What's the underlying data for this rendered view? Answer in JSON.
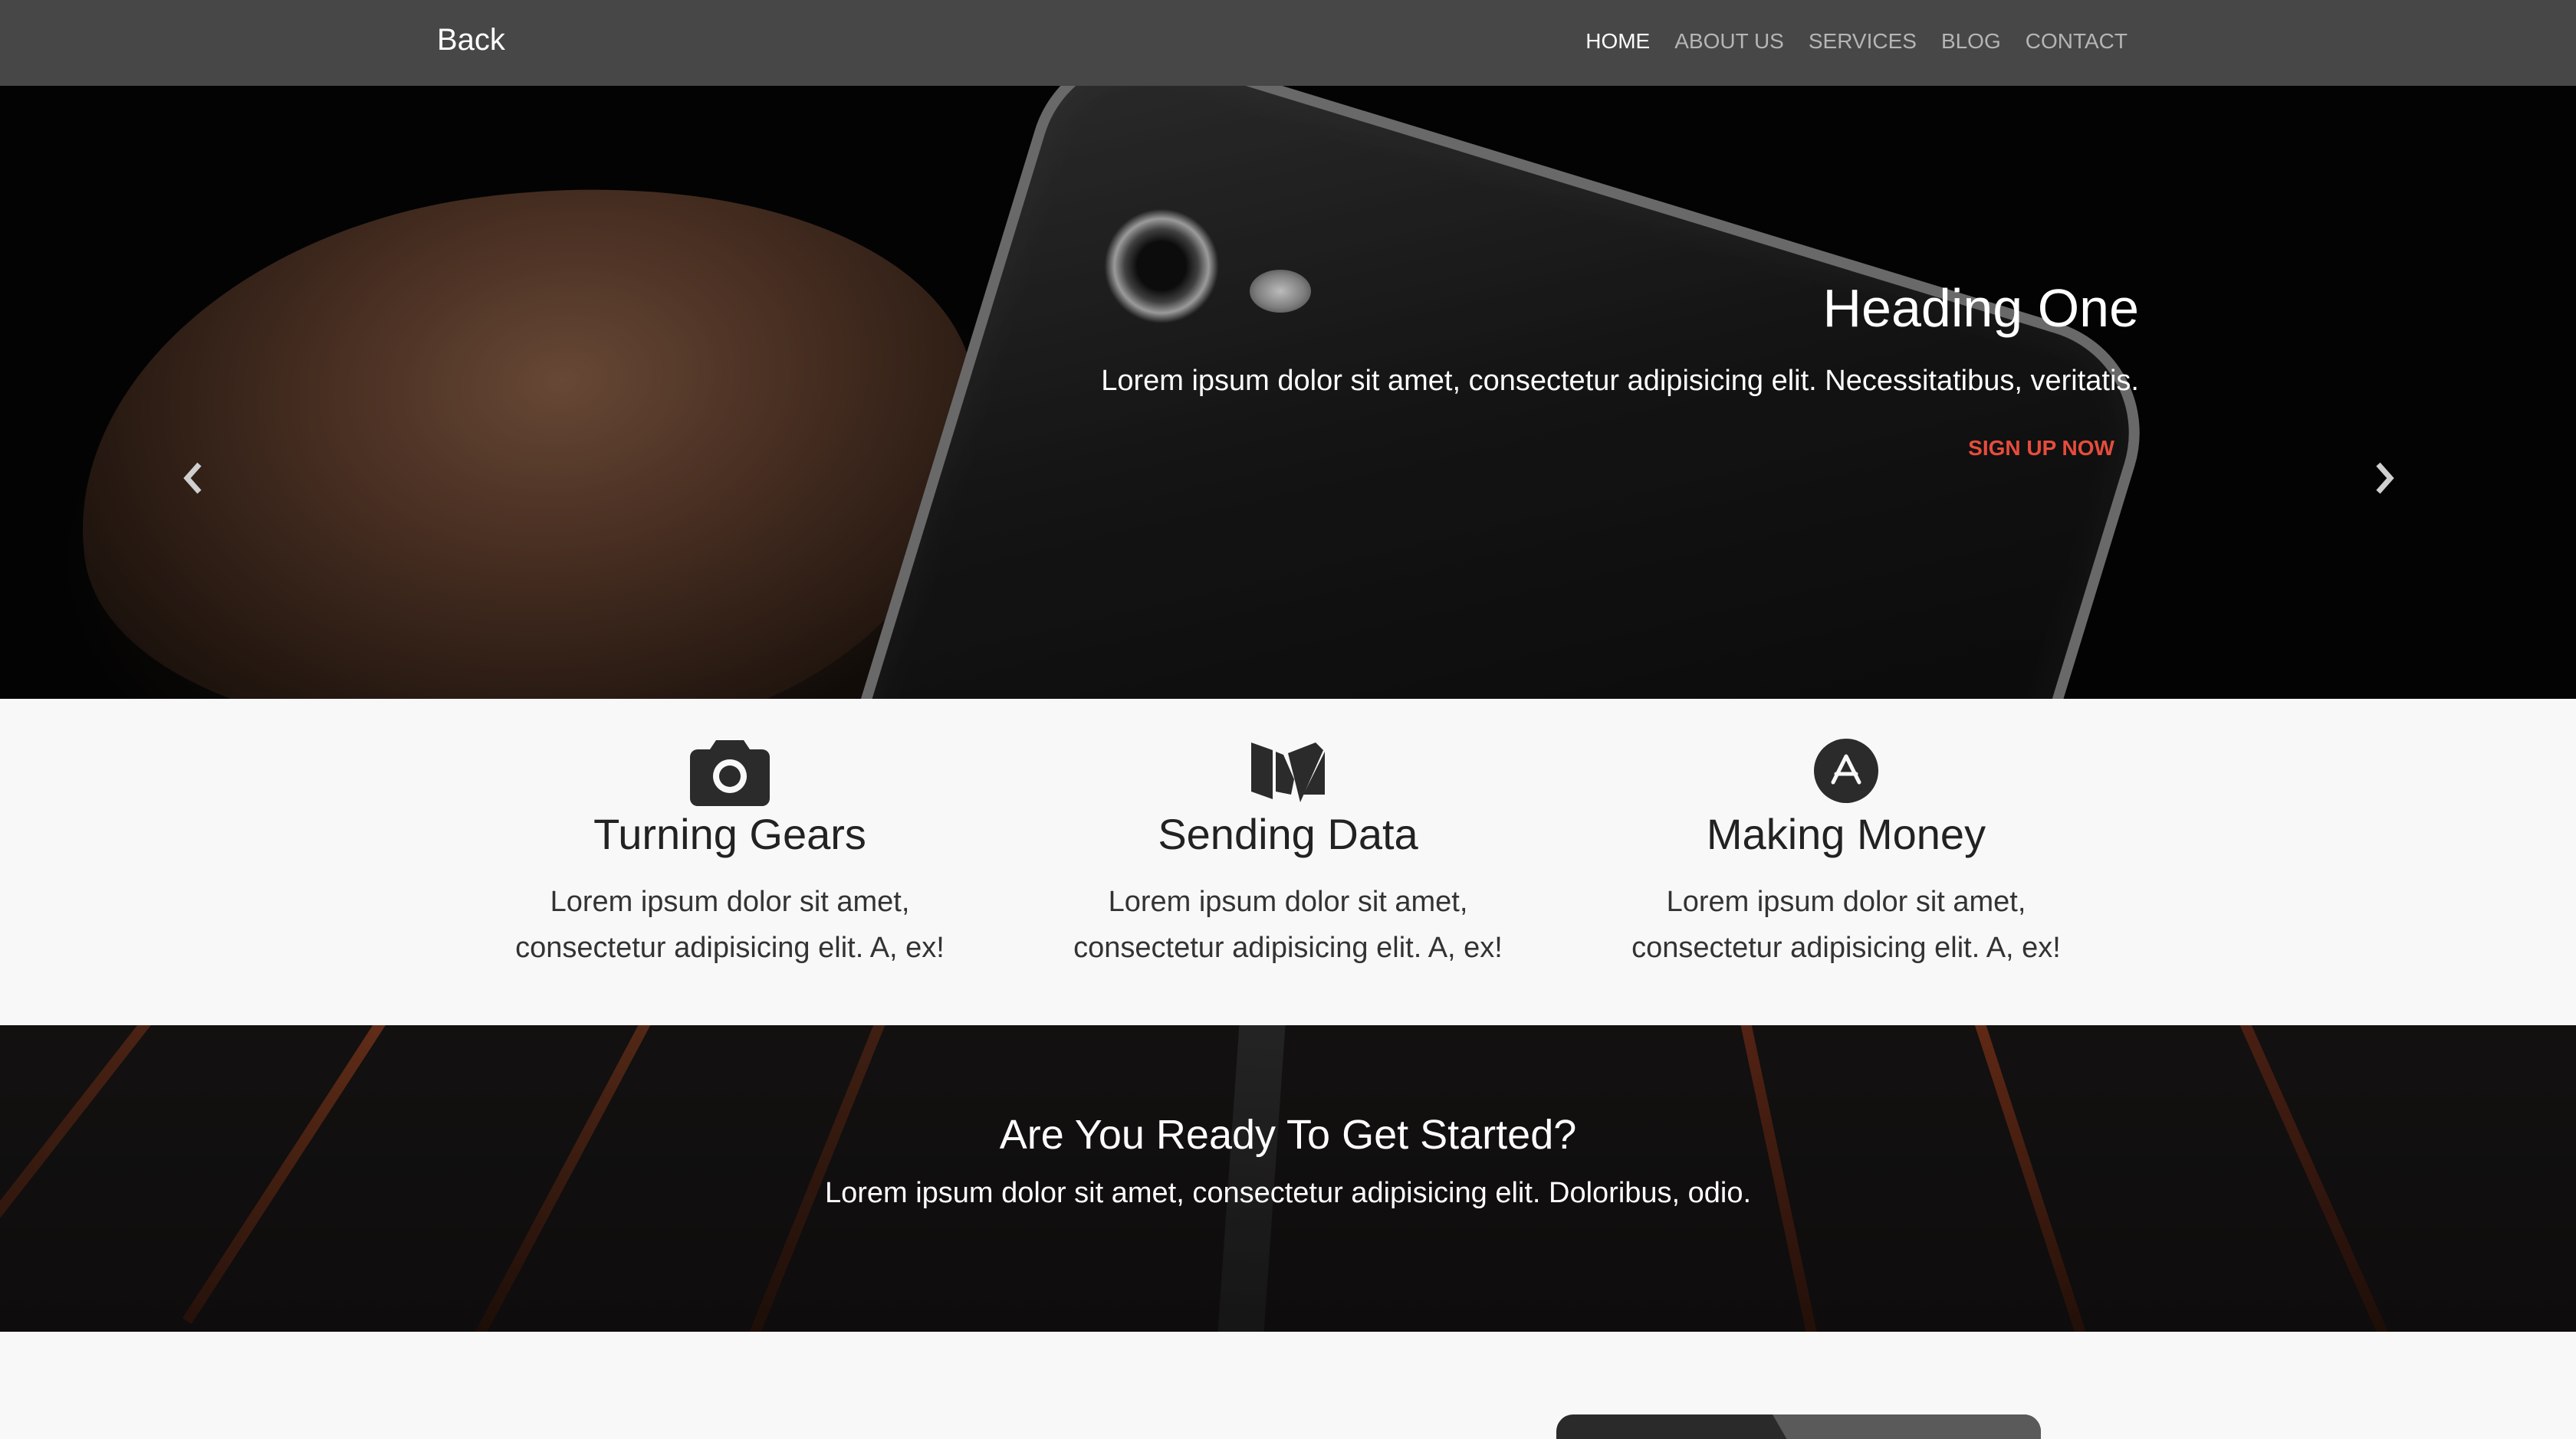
{
  "navbar": {
    "brand": "Back",
    "links": [
      {
        "label": "HOME",
        "active": true
      },
      {
        "label": "ABOUT US",
        "active": false
      },
      {
        "label": "SERVICES",
        "active": false
      },
      {
        "label": "BLOG",
        "active": false
      },
      {
        "label": "CONTACT",
        "active": false
      }
    ]
  },
  "hero": {
    "heading": "Heading One",
    "text": "Lorem ipsum dolor sit amet, consectetur adipisicing elit. Necessitatibus, veritatis.",
    "cta_label": "SIGN UP NOW",
    "cta_color": "#e74c3c",
    "active_slide": 1,
    "slide_count": 3
  },
  "features": [
    {
      "icon": "camera-icon",
      "title": "Turning Gears",
      "text_line1": "Lorem ipsum dolor sit amet,",
      "text_line2": "consectetur adipisicing elit. A, ex!"
    },
    {
      "icon": "medium-icon",
      "title": "Sending Data",
      "text_line1": "Lorem ipsum dolor sit amet,",
      "text_line2": "consectetur adipisicing elit. A, ex!"
    },
    {
      "icon": "app-store-icon",
      "title": "Making Money",
      "text_line1": "Lorem ipsum dolor sit amet,",
      "text_line2": "consectetur adipisicing elit. A, ex!"
    }
  ],
  "cta": {
    "heading": "Are You Ready To Get Started?",
    "text": "Lorem ipsum dolor sit amet, consectetur adipisicing elit. Doloribus, odio."
  }
}
